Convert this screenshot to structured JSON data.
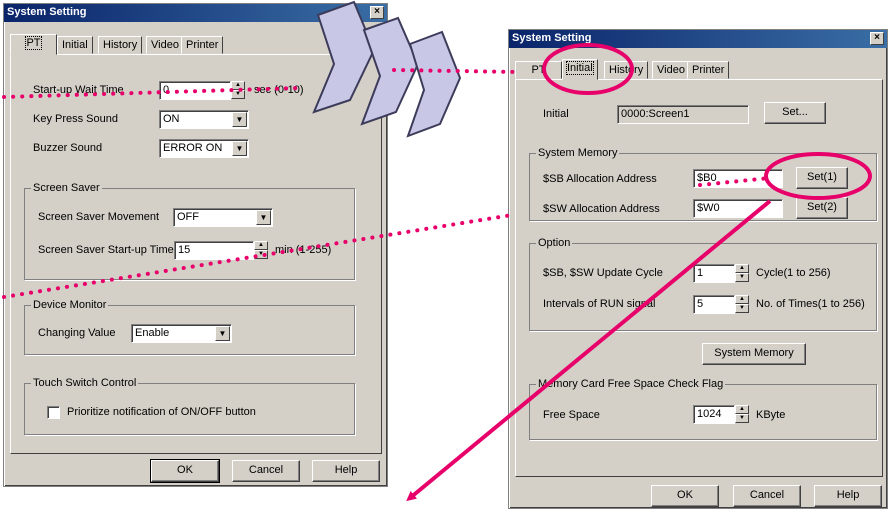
{
  "left": {
    "title": "System Setting",
    "close": "×",
    "tabs": [
      "PT",
      "Initial",
      "History",
      "Video",
      "Printer"
    ],
    "startup_wait": {
      "label": "Start-up Wait Time",
      "value": "0",
      "unit": "sec (0-10)"
    },
    "key_press": {
      "label": "Key Press Sound",
      "value": "ON"
    },
    "buzzer": {
      "label": "Buzzer Sound",
      "value": "ERROR ON"
    },
    "screen_saver": {
      "title": "Screen Saver",
      "movement_label": "Screen Saver Movement",
      "movement_value": "OFF",
      "startup_label": "Screen Saver Start-up Time",
      "startup_value": "15",
      "startup_unit": "min (1-255)"
    },
    "device_monitor": {
      "title": "Device Monitor",
      "label": "Changing Value",
      "value": "Enable"
    },
    "touch_switch": {
      "title": "Touch Switch Control",
      "check_label": "Prioritize notification of ON/OFF button"
    },
    "buttons": {
      "ok": "OK",
      "cancel": "Cancel",
      "help": "Help"
    }
  },
  "right": {
    "title": "System Setting",
    "close": "×",
    "tabs": [
      "PT",
      "Initial",
      "History",
      "Video",
      "Printer"
    ],
    "initial": {
      "label": "Initial",
      "value": "0000:Screen1",
      "set": "Set..."
    },
    "system_memory": {
      "title": "System Memory",
      "sb_label": "$SB Allocation Address",
      "sb_value": "$B0",
      "sb_button": "Set(1)",
      "sw_label": "$SW Allocation Address",
      "sw_value": "$W0",
      "sw_button": "Set(2)"
    },
    "option": {
      "title": "Option",
      "update_label": "$SB, $SW Update Cycle",
      "update_value": "1",
      "update_unit": "Cycle(1 to 256)",
      "run_label": "Intervals of RUN signal",
      "run_value": "5",
      "run_unit": "No. of Times(1 to 256)"
    },
    "system_memory_button": "System Memory",
    "memory_card": {
      "title": "Memory Card Free Space Check Flag",
      "label": "Free Space",
      "value": "1024",
      "unit": "KByte"
    },
    "buttons": {
      "ok": "OK",
      "cancel": "Cancel",
      "help": "Help"
    }
  },
  "colors": {
    "annotation": "#e8006a",
    "title_bar": "#0a246a",
    "arrow_fill": "#c8c8e6",
    "arrow_edge": "#3c3c5a"
  }
}
